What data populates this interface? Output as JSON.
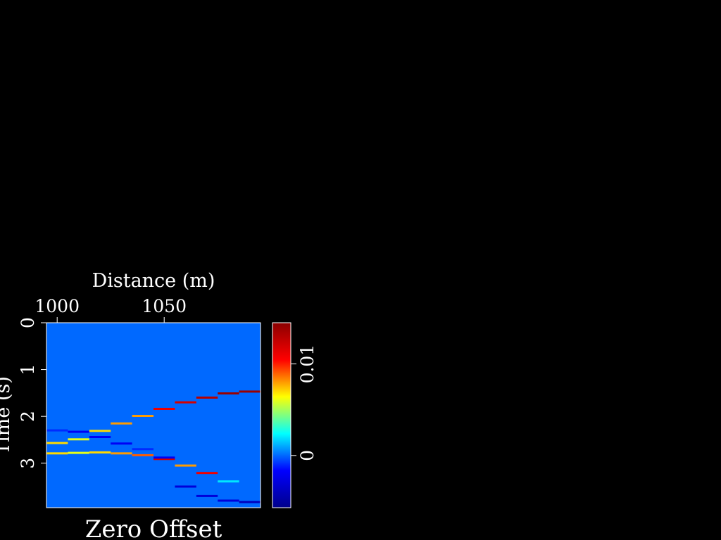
{
  "chart_data": {
    "type": "heatmap",
    "title": "Zero Offset",
    "xlabel": "Distance (m)",
    "ylabel": "Time (s)",
    "x_axis_position": "top",
    "xlim": [
      995,
      1095
    ],
    "ylim": [
      0,
      3.95
    ],
    "y_inverted": true,
    "x_ticks": [
      1000,
      1050
    ],
    "y_ticks": [
      0,
      1,
      2,
      3
    ],
    "background_value": 0,
    "traces": [
      1000,
      1010,
      1020,
      1030,
      1040,
      1050,
      1060,
      1070,
      1080,
      1090
    ],
    "events": [
      {
        "times": [
          2.57,
          2.49,
          2.31,
          2.15,
          1.99,
          1.84,
          1.7,
          1.6,
          1.51,
          1.47
        ],
        "amplitudes": [
          0.007,
          0.006,
          0.007,
          0.008,
          0.008,
          0.011,
          0.012,
          0.013,
          0.014,
          0.014
        ]
      },
      {
        "times": [
          2.79,
          2.78,
          2.77,
          2.79,
          2.83,
          2.91,
          3.05,
          3.21,
          3.39,
          3.59
        ],
        "amplitudes": [
          0.007,
          0.006,
          0.007,
          0.008,
          0.009,
          0.012,
          0.008,
          0.011,
          0.002,
          0.0
        ]
      },
      {
        "times": [
          2.3,
          2.33,
          2.44,
          2.58,
          2.7,
          2.88,
          3.5,
          3.7,
          3.8,
          3.83
        ],
        "amplitudes": [
          -0.001,
          -0.002,
          -0.002,
          -0.002,
          -0.001,
          -0.002,
          -0.003,
          -0.003,
          -0.003,
          -0.004
        ]
      }
    ],
    "colorbar": {
      "min": -0.0057,
      "max": 0.0145,
      "ticks": [
        0,
        0.01
      ],
      "tick_labels": [
        "0",
        "0.01"
      ],
      "colormap": [
        "#00008b",
        "#0000ff",
        "#00ffff",
        "#ffff00",
        "#ff0000",
        "#8b0000"
      ]
    }
  }
}
